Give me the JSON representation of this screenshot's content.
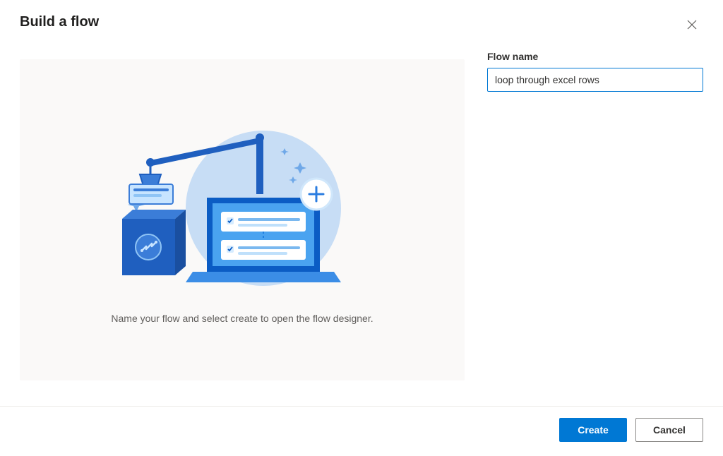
{
  "dialog": {
    "title": "Build a flow",
    "instruction": "Name your flow and select create to open the flow designer."
  },
  "form": {
    "flow_name_label": "Flow name",
    "flow_name_value": "loop through excel rows"
  },
  "footer": {
    "create_label": "Create",
    "cancel_label": "Cancel"
  },
  "colors": {
    "primary": "#0078d4",
    "panel_bg": "#faf9f8",
    "border": "#edebe9",
    "text": "#323130",
    "text_secondary": "#605e5c"
  }
}
